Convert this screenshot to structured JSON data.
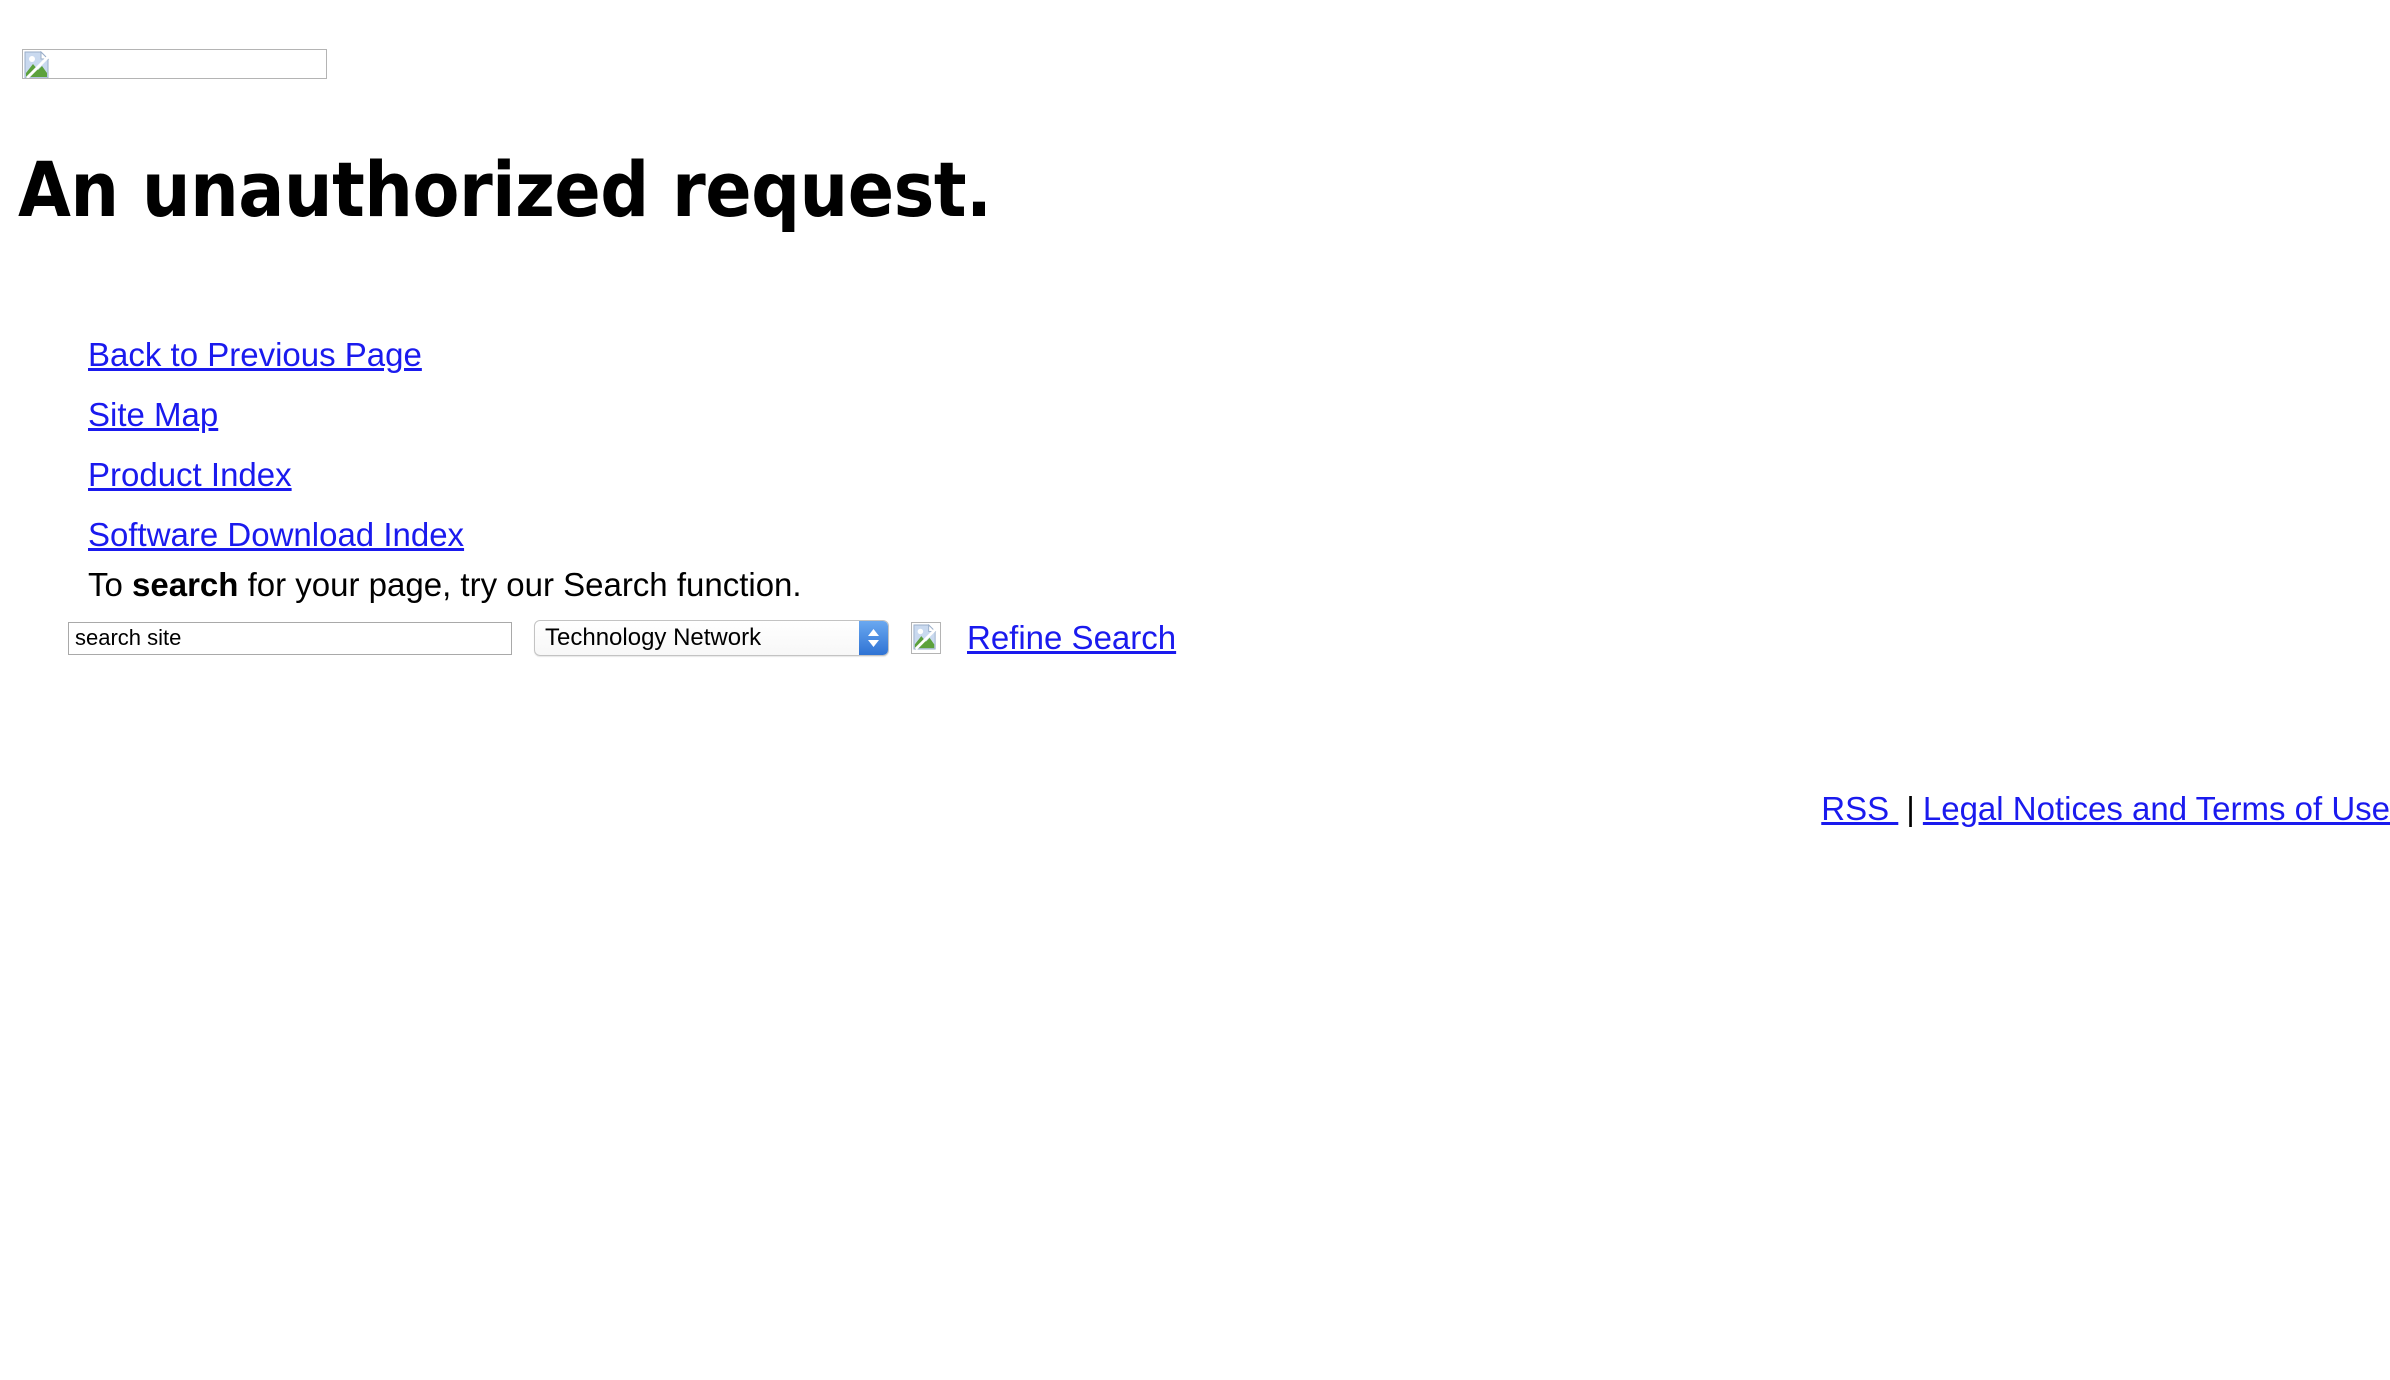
{
  "header": {
    "logo_alt": "",
    "logo_icon": "broken-image-icon"
  },
  "main": {
    "title": "An unauthorized request.",
    "links": [
      {
        "label": "Back to Previous Page"
      },
      {
        "label": "Site Map"
      },
      {
        "label": "Product Index"
      },
      {
        "label": "Software Download Index"
      }
    ],
    "search_prompt": {
      "prefix": "To ",
      "emphasis": "search",
      "suffix": " for your page, try our Search function."
    }
  },
  "search_form": {
    "input_value": "search site",
    "input_placeholder": "search site",
    "select_selected": "Technology Network",
    "select_options": [
      "Technology Network"
    ],
    "submit_icon": "broken-image-icon",
    "submit_alt": "",
    "refine_label": "Refine Search"
  },
  "footer": {
    "rss_label": "RSS ",
    "separator": "|",
    "legal_label": "Legal Notices and Terms of Use"
  },
  "colors": {
    "link": "#1a1aee",
    "text": "#000000",
    "background": "#ffffff",
    "select_accent": "#2f73d4",
    "border": "#b4b4b4"
  }
}
